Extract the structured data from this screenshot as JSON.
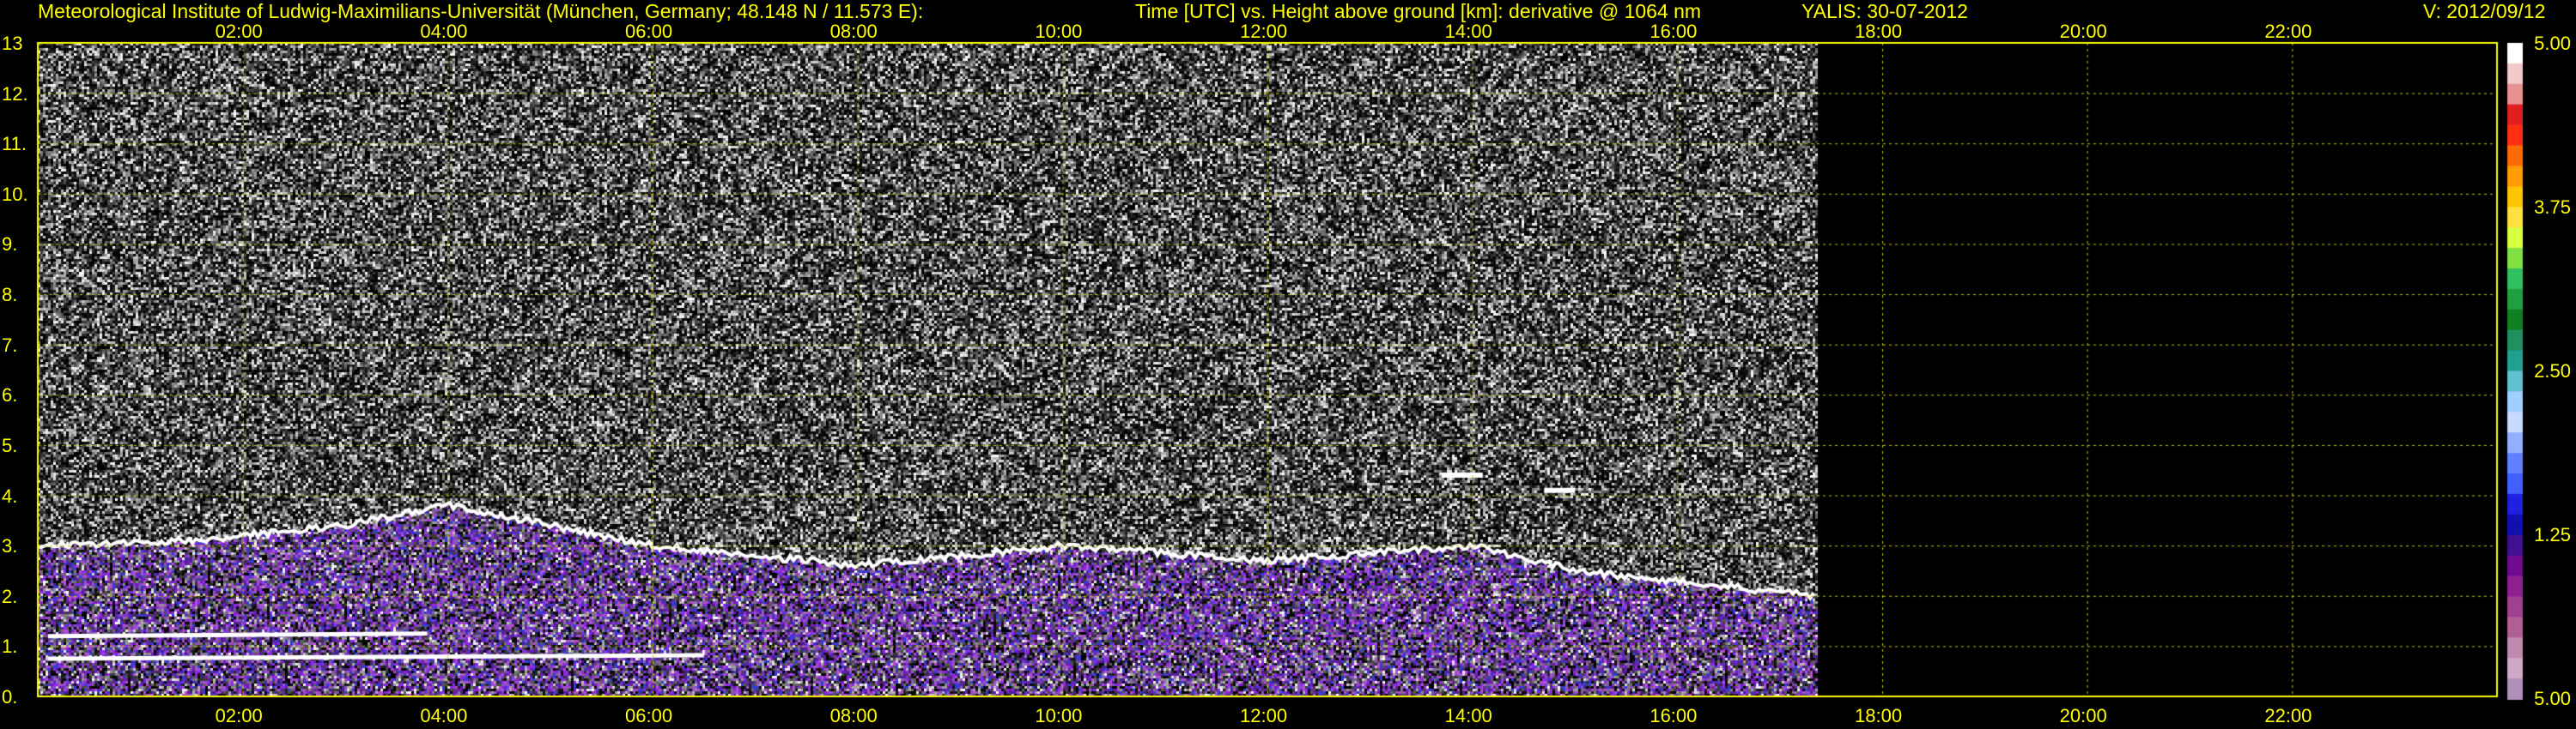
{
  "header": {
    "institute": "Meteorological Institute of Ludwig-Maximilians-Universität (München, Germany; 48.148 N / 11.573 E):",
    "axes_desc": "Time [UTC] vs. Height above ground [km]: derivative @ 1064 nm",
    "station_date": "YALIS: 30-07-2012",
    "version": "V: 2012/09/12"
  },
  "chart_data": {
    "type": "heatmap",
    "title": "Time [UTC] vs. Height above ground [km]: derivative @ 1064 nm",
    "xlabel": "Time [UTC]",
    "ylabel": "Height above ground [km]",
    "x_ticks": [
      "02:00",
      "04:00",
      "06:00",
      "08:00",
      "10:00",
      "12:00",
      "14:00",
      "16:00",
      "18:00",
      "20:00",
      "22:00"
    ],
    "x_tick_hours": [
      2,
      4,
      6,
      8,
      10,
      12,
      14,
      16,
      18,
      20,
      22
    ],
    "xlim_hours": [
      0,
      24
    ],
    "y_ticks": [
      "0.",
      "1.",
      "2.",
      "3.",
      "4.",
      "5.",
      "6.",
      "7.",
      "8.",
      "9.",
      "10.",
      "11.",
      "12.",
      "13"
    ],
    "y_tick_values": [
      0,
      1,
      2,
      3,
      4,
      5,
      6,
      7,
      8,
      9,
      10,
      11,
      12,
      13
    ],
    "ylim": [
      0,
      13
    ],
    "data_end_hour": 17.35,
    "grid": true,
    "colorbar": {
      "labels": [
        "5.00",
        "3.75",
        "2.50",
        "1.25",
        "5.00"
      ],
      "position": "right"
    },
    "features": {
      "boundary_layer_top_km": [
        {
          "hour": 0.0,
          "km": 3.0
        },
        {
          "hour": 1.5,
          "km": 3.1
        },
        {
          "hour": 3.0,
          "km": 3.4
        },
        {
          "hour": 4.0,
          "km": 3.8
        },
        {
          "hour": 6.0,
          "km": 3.0
        },
        {
          "hour": 8.0,
          "km": 2.6
        },
        {
          "hour": 10.0,
          "km": 3.0
        },
        {
          "hour": 12.0,
          "km": 2.7
        },
        {
          "hour": 14.0,
          "km": 3.0
        },
        {
          "hour": 15.0,
          "km": 2.5
        },
        {
          "hour": 17.35,
          "km": 2.0
        }
      ],
      "elevated_layer_km": [
        {
          "hour": 13.7,
          "km": 4.4
        },
        {
          "hour": 14.7,
          "km": 4.1
        }
      ]
    }
  }
}
